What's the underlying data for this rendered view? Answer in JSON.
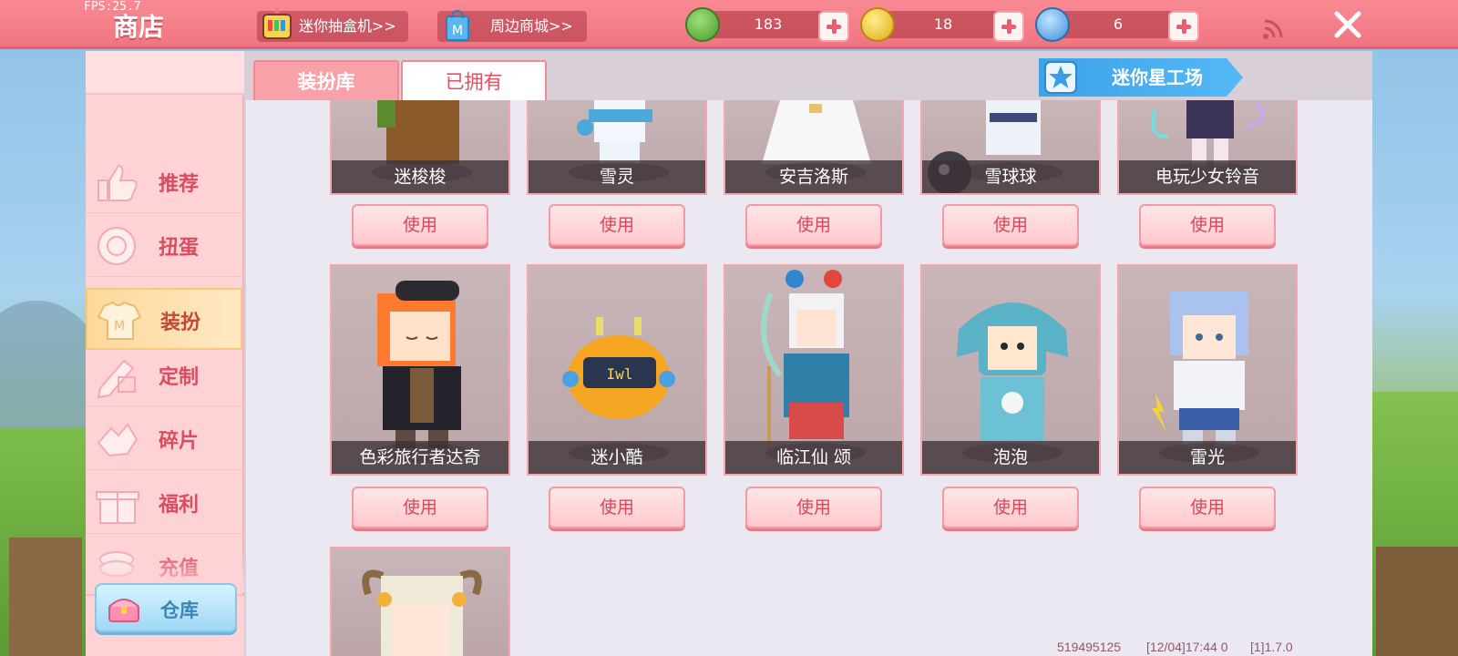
{
  "fps": "FPS:25.7",
  "title": "商店",
  "topbar": {
    "gacha_label": "迷你抽盒机>>",
    "mall_label": "周边商城>>",
    "currencies": [
      {
        "icon": "green-bean-coin-icon",
        "value": "183",
        "color": "#5cb340"
      },
      {
        "icon": "gold-coin-icon",
        "value": "18",
        "color": "#f2c230"
      },
      {
        "icon": "mini-coin-icon",
        "value": "6",
        "color": "#58a8e8"
      }
    ]
  },
  "sidebar": {
    "items": [
      {
        "label": "推荐",
        "icon": "thumbs-up-icon"
      },
      {
        "label": "扭蛋",
        "icon": "capsule-icon"
      },
      {
        "label": "装扮",
        "icon": "shirt-icon"
      },
      {
        "label": "定制",
        "icon": "pencil-icon"
      },
      {
        "label": "碎片",
        "icon": "fragment-icon"
      },
      {
        "label": "福利",
        "icon": "gift-icon"
      },
      {
        "label": "充值",
        "icon": "coin-stack-icon"
      }
    ],
    "warehouse_label": "仓库"
  },
  "tabs": [
    {
      "label": "装扮库",
      "active": false
    },
    {
      "label": "已拥有",
      "active": true
    }
  ],
  "star_workshop_label": "迷你星工场",
  "cards_row1": [
    {
      "name": "迷梭梭"
    },
    {
      "name": "雪灵"
    },
    {
      "name": "安吉洛斯"
    },
    {
      "name": "雪球球"
    },
    {
      "name": "电玩少女铃音"
    }
  ],
  "cards_row2": [
    {
      "name": "色彩旅行者达奇"
    },
    {
      "name": "迷小酷"
    },
    {
      "name": "临江仙 颂"
    },
    {
      "name": "泡泡"
    },
    {
      "name": "雷光"
    }
  ],
  "use_label": "使用",
  "footer": {
    "uid": "519495125",
    "time": "[12/04]17:44 0",
    "version": "[1]1.7.0"
  }
}
